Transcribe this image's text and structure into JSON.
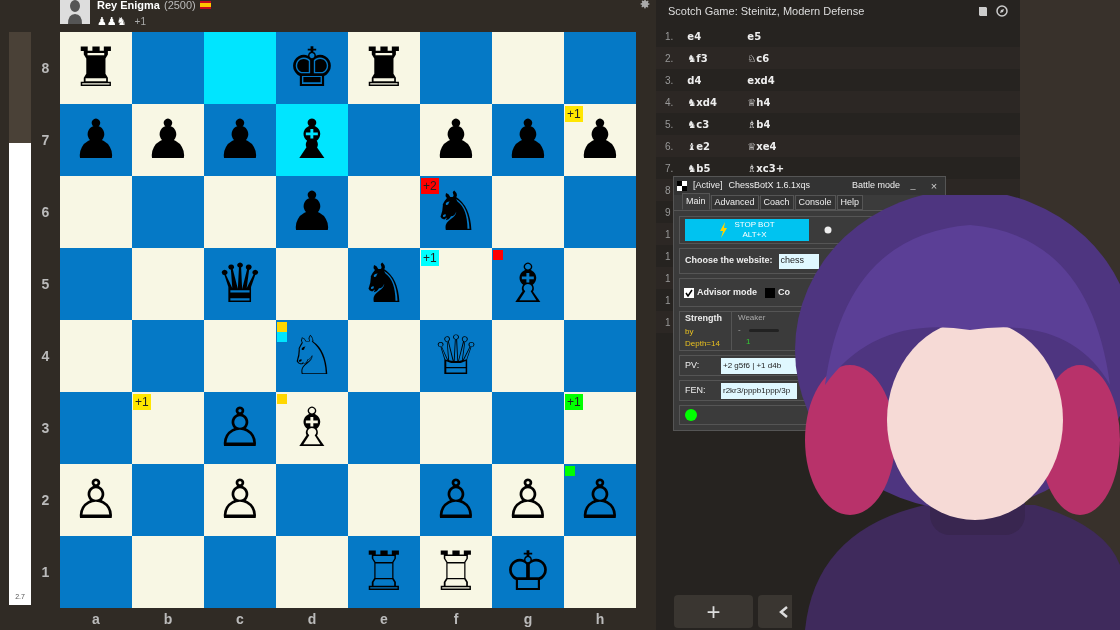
{
  "player": {
    "name": "Rey Enigma",
    "rating": "(2500)",
    "captured": "♟♟♞",
    "advantage": "+1"
  },
  "eval_bar": {
    "level": 0.806,
    "reading": "2.7"
  },
  "board": {
    "ranks": [
      {
        "label": "8",
        "squares": [
          {
            "piece": "♜",
            "highlighted": false
          },
          {
            "highlighted": false
          },
          {
            "highlighted": true
          },
          {
            "piece": "♚",
            "highlighted": false
          },
          {
            "piece": "♜",
            "highlighted": false
          },
          {
            "highlighted": false
          },
          {
            "highlighted": false
          },
          {
            "highlighted": false
          }
        ]
      },
      {
        "label": "7",
        "squares": [
          {
            "piece": "♟",
            "highlighted": false
          },
          {
            "piece": "♟",
            "highlighted": false
          },
          {
            "piece": "♟",
            "highlighted": false
          },
          {
            "piece": "♝",
            "highlighted": true
          },
          {
            "highlighted": false
          },
          {
            "piece": "♟",
            "highlighted": false
          },
          {
            "piece": "♟",
            "highlighted": false
          },
          {
            "piece": "♟",
            "highlighted": false,
            "badge": {
              "text": "+1",
              "color": "#ffe600"
            }
          }
        ]
      },
      {
        "label": "6",
        "squares": [
          {
            "highlighted": false
          },
          {
            "highlighted": false
          },
          {
            "highlighted": false
          },
          {
            "piece": "♟",
            "highlighted": false
          },
          {
            "highlighted": false
          },
          {
            "piece": "♞",
            "highlighted": false,
            "badge": {
              "text": "+2",
              "color": "#ff0000"
            }
          },
          {
            "highlighted": false
          },
          {
            "highlighted": false
          }
        ]
      },
      {
        "label": "5",
        "squares": [
          {
            "highlighted": false
          },
          {
            "highlighted": false
          },
          {
            "piece": "♛",
            "highlighted": false
          },
          {
            "highlighted": false
          },
          {
            "piece": "♞",
            "highlighted": false
          },
          {
            "highlighted": false,
            "badge": {
              "text": "+1",
              "color": "#00ffff"
            }
          },
          {
            "piece": "♗",
            "highlighted": false,
            "markers": [
              {
                "color": "#ff0000"
              }
            ]
          },
          {
            "highlighted": false
          }
        ]
      },
      {
        "label": "4",
        "squares": [
          {
            "highlighted": false
          },
          {
            "highlighted": false
          },
          {
            "highlighted": false
          },
          {
            "piece": "♘",
            "highlighted": false,
            "markers": [
              {
                "color": "#ffd700"
              },
              {
                "color": "#00e5ff"
              }
            ]
          },
          {
            "highlighted": false
          },
          {
            "piece": "♕",
            "highlighted": false
          },
          {
            "highlighted": false
          },
          {
            "highlighted": false
          }
        ]
      },
      {
        "label": "3",
        "squares": [
          {
            "highlighted": false
          },
          {
            "highlighted": false,
            "badge": {
              "text": "+1",
              "color": "#ffe600"
            }
          },
          {
            "piece": "♙",
            "highlighted": false
          },
          {
            "piece": "♗",
            "highlighted": false,
            "markers": [
              {
                "color": "#ffd700"
              }
            ]
          },
          {
            "highlighted": false
          },
          {
            "highlighted": false
          },
          {
            "highlighted": false
          },
          {
            "highlighted": false,
            "badge": {
              "text": "+1",
              "color": "#00ff00"
            }
          }
        ]
      },
      {
        "label": "2",
        "squares": [
          {
            "piece": "♙",
            "highlighted": false
          },
          {
            "highlighted": false
          },
          {
            "piece": "♙",
            "highlighted": false
          },
          {
            "highlighted": false
          },
          {
            "highlighted": false
          },
          {
            "piece": "♙",
            "highlighted": false
          },
          {
            "piece": "♙",
            "highlighted": false
          },
          {
            "piece": "♙",
            "highlighted": false,
            "markers": [
              {
                "color": "#00ff00"
              }
            ]
          }
        ]
      },
      {
        "label": "1",
        "squares": [
          {
            "highlighted": false
          },
          {
            "highlighted": false
          },
          {
            "highlighted": false
          },
          {
            "highlighted": false
          },
          {
            "piece": "♖",
            "highlighted": false
          },
          {
            "piece": "♖",
            "highlighted": false
          },
          {
            "piece": "♔",
            "highlighted": false
          },
          {
            "highlighted": false
          }
        ]
      }
    ],
    "files": [
      "a",
      "b",
      "c",
      "d",
      "e",
      "f",
      "g",
      "h"
    ]
  },
  "opening": "Scotch Game: Steinitz, Modern Defense",
  "moves": [
    {
      "number": "1.",
      "white": "e4",
      "black": "e5"
    },
    {
      "number": "2.",
      "white": "♞f3",
      "black": "♘c6"
    },
    {
      "number": "3.",
      "white": "d4",
      "black": "exd4"
    },
    {
      "number": "4.",
      "white": "♞xd4",
      "black": "♕h4"
    },
    {
      "number": "5.",
      "white": "♞c3",
      "black": "♗b4"
    },
    {
      "number": "6.",
      "white": "♝e2",
      "black": "♕xe4"
    },
    {
      "number": "7.",
      "white": "♞b5",
      "black": "♗xc3+"
    },
    {
      "number": "8"
    },
    {
      "number": "9"
    },
    {
      "number": "1"
    },
    {
      "number": "1"
    },
    {
      "number": "1"
    },
    {
      "number": "1"
    },
    {
      "number": "1"
    }
  ],
  "bottom_buttons": {
    "add": "+"
  },
  "bot_window": {
    "status": "[Active]",
    "title": "ChessBotX 1.6.1xqs",
    "mode": "Battle mode",
    "minimize": "_",
    "close": "×",
    "tabs": [
      {
        "label": "Main",
        "selected": true
      },
      {
        "label": "Advanced",
        "selected": false
      },
      {
        "label": "Coach",
        "selected": false
      },
      {
        "label": "Console",
        "selected": false
      },
      {
        "label": "Help",
        "selected": false
      }
    ],
    "stop_button": {
      "label": "STOP BOT",
      "shortcut": "ALT+X"
    },
    "website": {
      "label": "Choose the website:",
      "value": "chess"
    },
    "options": [
      {
        "label": "Advisor mode",
        "checked": true
      },
      {
        "label": "Co",
        "checked": false
      }
    ],
    "strength": {
      "label": "Strength",
      "depth": "by Depth=14",
      "slider_label": "Weaker",
      "minus": "-",
      "value": "1"
    },
    "pv": {
      "label": "PV:",
      "value": "+2 g5f6 | +1 d4b"
    },
    "fen": {
      "label": "FEN:",
      "value": "r2kr3/pppb1ppp/3p"
    },
    "connected": true
  }
}
